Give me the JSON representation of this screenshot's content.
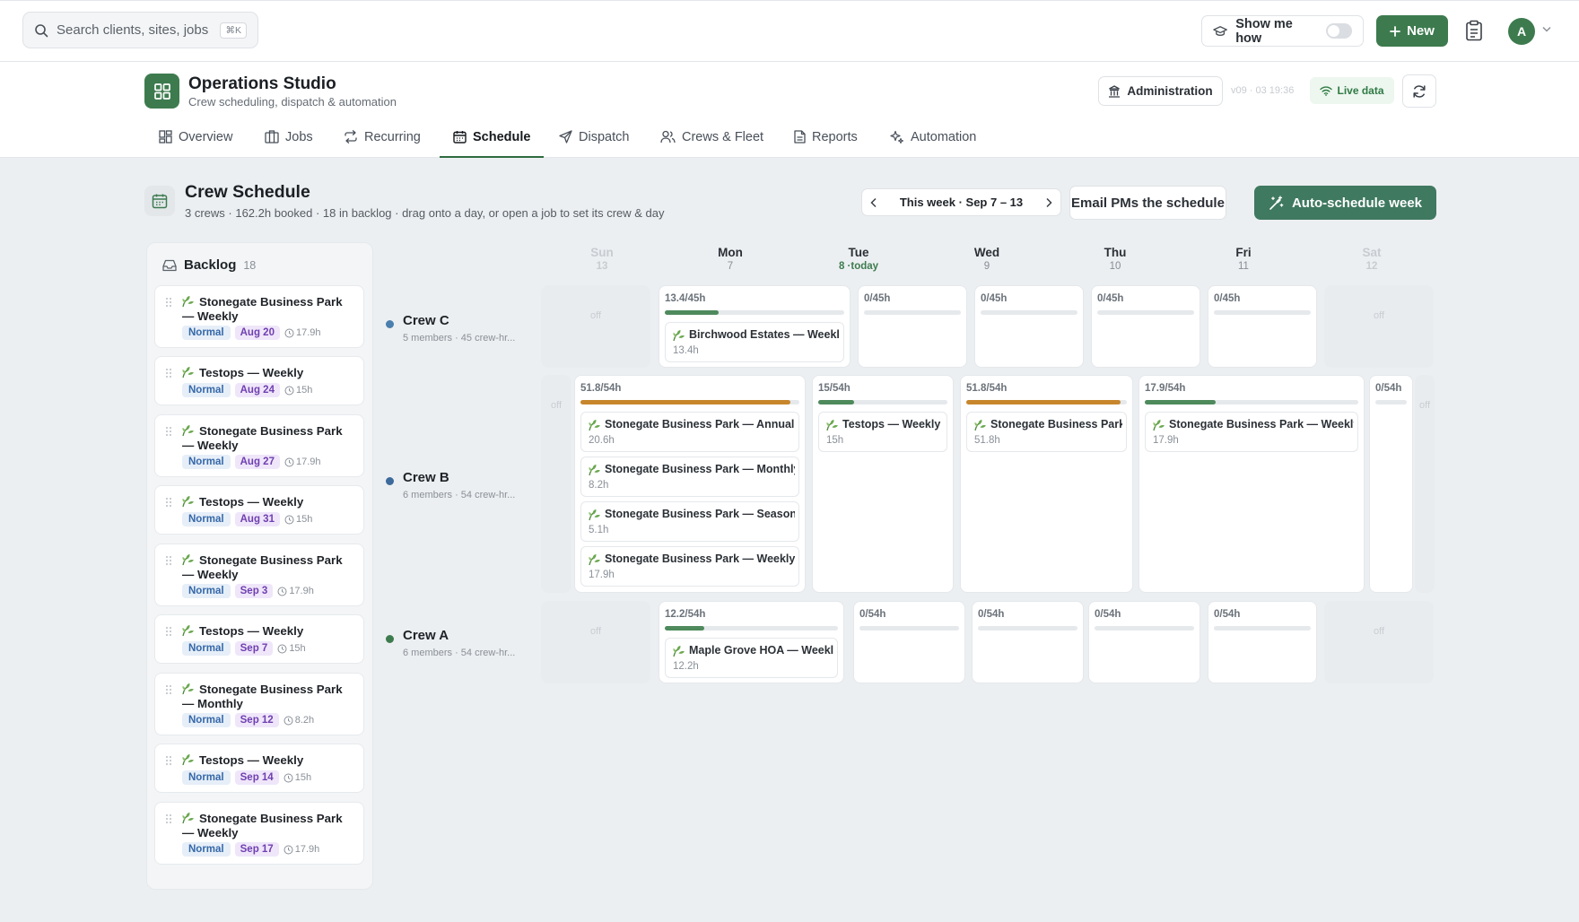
{
  "search": {
    "placeholder": "Search clients, sites, jobs",
    "shortcut": "⌘K"
  },
  "topbar": {
    "show_me_how": "Show me how",
    "new_label": "New",
    "avatar_initial": "A"
  },
  "app": {
    "title": "Operations Studio",
    "subtitle": "Crew scheduling, dispatch & automation",
    "admin_label": "Administration",
    "version": "v09 · 03 19:36",
    "live_label": "Live data"
  },
  "tabs": [
    "Overview",
    "Jobs",
    "Recurring",
    "Schedule",
    "Dispatch",
    "Crews & Fleet",
    "Reports",
    "Automation"
  ],
  "schedule": {
    "title": "Crew Schedule",
    "subtitle": "3 crews · 162.2h booked · 18 in backlog · drag onto a day, or open a job to set its crew & day",
    "week_label": "This week · Sep 7 – 13",
    "email_label": "Email PMs the schedule",
    "auto_label": "Auto-schedule week"
  },
  "backlog": {
    "title": "Backlog",
    "count": "18",
    "items": [
      {
        "title": "Stonegate Business Park — Weekly",
        "priority": "Normal",
        "date": "Aug 20",
        "hours": "17.9h"
      },
      {
        "title": "Testops — Weekly",
        "priority": "Normal",
        "date": "Aug 24",
        "hours": "15h"
      },
      {
        "title": "Stonegate Business Park — Weekly",
        "priority": "Normal",
        "date": "Aug 27",
        "hours": "17.9h"
      },
      {
        "title": "Testops — Weekly",
        "priority": "Normal",
        "date": "Aug 31",
        "hours": "15h"
      },
      {
        "title": "Stonegate Business Park — Weekly",
        "priority": "Normal",
        "date": "Sep 3",
        "hours": "17.9h"
      },
      {
        "title": "Testops — Weekly",
        "priority": "Normal",
        "date": "Sep 7",
        "hours": "15h"
      },
      {
        "title": "Stonegate Business Park — Monthly",
        "priority": "Normal",
        "date": "Sep 12",
        "hours": "8.2h"
      },
      {
        "title": "Testops — Weekly",
        "priority": "Normal",
        "date": "Sep 14",
        "hours": "15h"
      },
      {
        "title": "Stonegate Business Park — Weekly",
        "priority": "Normal",
        "date": "Sep 17",
        "hours": "17.9h"
      }
    ]
  },
  "days": [
    {
      "name": "Sun",
      "date": "13",
      "weekend": true
    },
    {
      "name": "Mon",
      "date": "7"
    },
    {
      "name": "Tue",
      "date": "8 ·today",
      "today": true
    },
    {
      "name": "Wed",
      "date": "9"
    },
    {
      "name": "Thu",
      "date": "10"
    },
    {
      "name": "Fri",
      "date": "11"
    },
    {
      "name": "Sat",
      "date": "12",
      "weekend": true
    }
  ],
  "off_label": "off",
  "crews": [
    {
      "name": "Crew C",
      "meta": "5 members · 45 crew-hr...",
      "color": "#4a7fae",
      "cells": [
        {
          "off": true
        },
        {
          "cap": "13.4/45h",
          "load": 0.3,
          "jobs": [
            {
              "title": "Birchwood Estates — Weekly",
              "hours": "13.4h"
            }
          ]
        },
        {
          "cap": "0/45h",
          "load": 0,
          "jobs": []
        },
        {
          "cap": "0/45h",
          "load": 0,
          "jobs": []
        },
        {
          "cap": "0/45h",
          "load": 0,
          "jobs": []
        },
        {
          "cap": "0/45h",
          "load": 0,
          "jobs": []
        },
        {
          "off": true
        }
      ]
    },
    {
      "name": "Crew B",
      "meta": "6 members · 54 crew-hr...",
      "color": "#3d6a9c",
      "cells": [
        {
          "off": true
        },
        {
          "cap": "51.8/54h",
          "load": 0.96,
          "jobs": [
            {
              "title": "Stonegate Business Park — Annual",
              "hours": "20.6h"
            },
            {
              "title": "Stonegate Business Park — Monthly",
              "hours": "8.2h"
            },
            {
              "title": "Stonegate Business Park — Seasonal",
              "hours": "5.1h"
            },
            {
              "title": "Stonegate Business Park — Weekly",
              "hours": "17.9h"
            }
          ]
        },
        {
          "cap": "15/54h",
          "load": 0.28,
          "jobs": [
            {
              "title": "Testops — Weekly",
              "hours": "15h"
            }
          ]
        },
        {
          "cap": "51.8/54h",
          "load": 0.96,
          "jobs": [
            {
              "title": "Stonegate Business Park — Weekly",
              "hours": "51.8h"
            }
          ]
        },
        {
          "cap": "17.9/54h",
          "load": 0.33,
          "jobs": [
            {
              "title": "Stonegate Business Park — Weekly",
              "hours": "17.9h"
            }
          ]
        },
        {
          "cap": "0/54h",
          "load": 0,
          "jobs": []
        },
        {
          "off": true
        }
      ]
    },
    {
      "name": "Crew A",
      "meta": "6 members · 54 crew-hr...",
      "color": "#3d7b4e",
      "cells": [
        {
          "off": true
        },
        {
          "cap": "12.2/54h",
          "load": 0.23,
          "jobs": [
            {
              "title": "Maple Grove HOA — Weekly",
              "hours": "12.2h"
            }
          ]
        },
        {
          "cap": "0/54h",
          "load": 0,
          "jobs": []
        },
        {
          "cap": "0/54h",
          "load": 0,
          "jobs": []
        },
        {
          "cap": "0/54h",
          "load": 0,
          "jobs": []
        },
        {
          "cap": "0/54h",
          "load": 0,
          "jobs": []
        },
        {
          "off": true
        }
      ]
    }
  ],
  "colors": {
    "accent": "#3d7b4e",
    "over": "#c8862c",
    "normal_load": "#4e8a5c"
  }
}
